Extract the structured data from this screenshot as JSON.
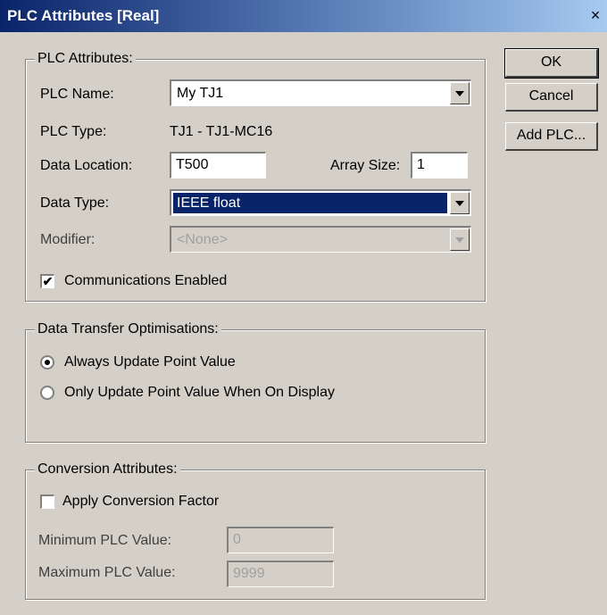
{
  "window": {
    "title": "PLC Attributes  [Real]",
    "close_glyph": "×"
  },
  "buttons": {
    "ok": "OK",
    "cancel": "Cancel",
    "add_plc": "Add PLC..."
  },
  "plc_group": {
    "legend": "PLC Attributes:",
    "plc_name_label": "PLC Name:",
    "plc_name_value": "My TJ1",
    "plc_type_label": "PLC Type:",
    "plc_type_value": "TJ1 - TJ1-MC16",
    "data_location_label": "Data Location:",
    "data_location_value": "T500",
    "array_size_label": "Array Size:",
    "array_size_value": "1",
    "data_type_label": "Data Type:",
    "data_type_value": "IEEE float",
    "modifier_label": "Modifier:",
    "modifier_value": "<None>",
    "comms_enabled_label": "Communications Enabled",
    "comms_enabled_checked": true
  },
  "transfer_group": {
    "legend": "Data Transfer Optimisations:",
    "option_always": "Always Update Point Value",
    "option_on_display": "Only Update Point Value When On Display",
    "selected": "always"
  },
  "conversion_group": {
    "legend": "Conversion Attributes:",
    "apply_label": "Apply Conversion Factor",
    "apply_checked": false,
    "min_label": "Minimum PLC Value:",
    "min_value": "0",
    "max_label": "Maximum PLC Value:",
    "max_value": "9999"
  },
  "icons": {
    "checkmark": "✔",
    "close": "close-icon",
    "dropdown": "chevron-down-icon"
  },
  "colors": {
    "title_start": "#0a246a",
    "title_end": "#a6caf0",
    "dialog_bg": "#d4d0c8",
    "selection": "#0a246a"
  }
}
